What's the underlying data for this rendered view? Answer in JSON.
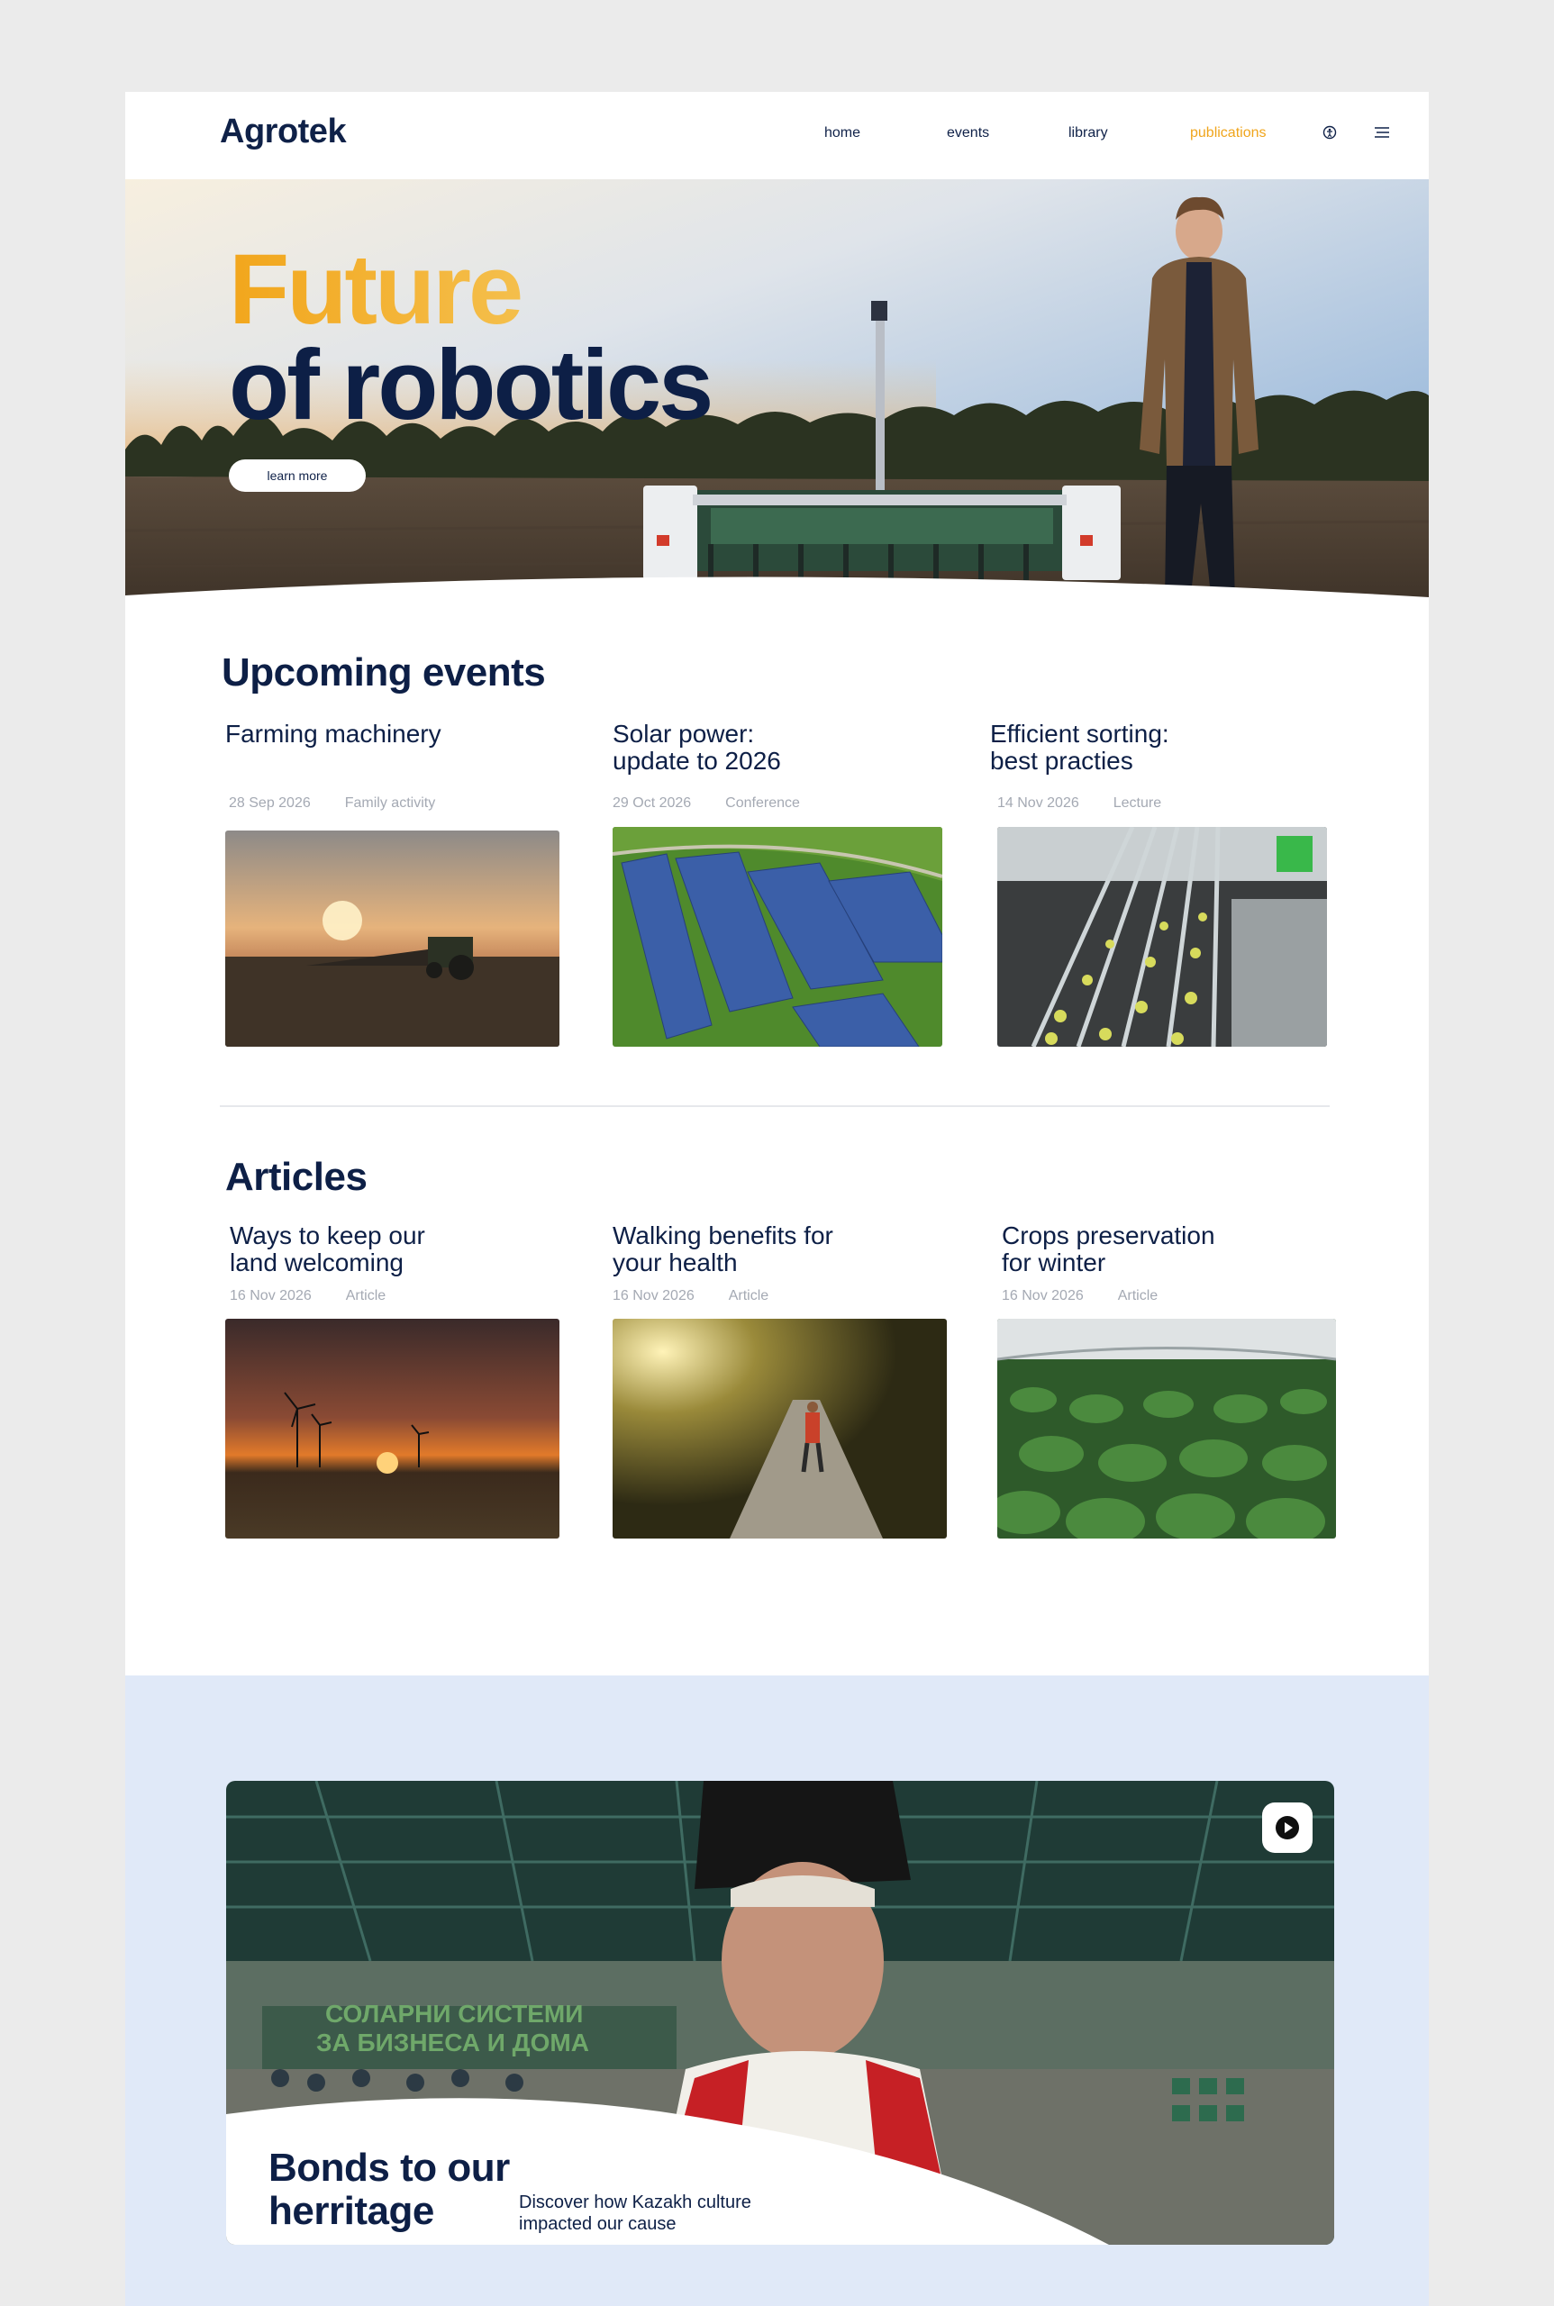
{
  "nav": {
    "logo": "Agrotek",
    "links": [
      "home",
      "events",
      "library",
      "publications"
    ],
    "active": "publications",
    "icons": [
      "accessibility-icon",
      "menu-icon"
    ]
  },
  "hero": {
    "title_line1": "Future",
    "title_line2": "of robotics",
    "button": "learn more"
  },
  "events": {
    "title": "Upcoming events",
    "items": [
      {
        "title": "Farming machinery",
        "date": "28 Sep 2026",
        "type": "Family activity",
        "image": "tractor-sunset-photo"
      },
      {
        "title": "Solar power:\nupdate to 2026",
        "date": "29 Oct 2026",
        "type": "Conference",
        "image": "solar-farm-aerial-photo"
      },
      {
        "title": "Efficient sorting:\nbest practies",
        "date": "14 Nov 2026",
        "type": "Lecture",
        "image": "sorting-conveyor-photo"
      }
    ]
  },
  "articles": {
    "title": "Articles",
    "items": [
      {
        "title": "Ways to keep our\nland welcoming",
        "date": "16 Nov 2026",
        "type": "Article",
        "image": "wind-turbines-sunset-photo"
      },
      {
        "title": "Walking benefits for\nyour health",
        "date": "16 Nov 2026",
        "type": "Article",
        "image": "woman-walking-path-photo"
      },
      {
        "title": "Crops preservation\nfor winter",
        "date": "16 Nov 2026",
        "type": "Article",
        "image": "greenhouse-crops-photo"
      }
    ]
  },
  "heritage": {
    "title": "Bonds to our\nherritage",
    "description": "Discover how Kazakh culture\nimpacted our cause",
    "banner_text": "СОЛАРНИ СИСТЕМИ\nЗА БИЗНЕСА И ДОМА"
  },
  "colors": {
    "navy": "#0d1f46",
    "accent": "#f0a51c",
    "muted": "#a4a9b3",
    "band": "#e0e9f8"
  }
}
